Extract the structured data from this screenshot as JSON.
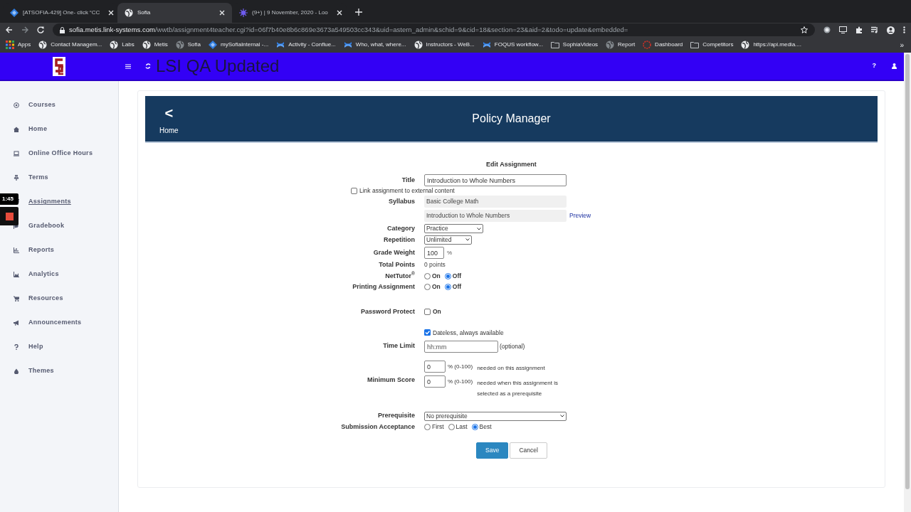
{
  "browser": {
    "tabs": [
      {
        "title": "[ATSOFIA-429] One- click “CC",
        "kind": "diamond",
        "selected": false
      },
      {
        "title": "Sofia",
        "kind": "globe",
        "selected": true
      },
      {
        "title": "(9+) | 9 November, 2020 - Loo",
        "kind": "star",
        "selected": false
      }
    ],
    "url": {
      "host": "sofia.metis.link-systems.com",
      "path": "/wwtb/assignment4teacher.cgi?id=06f7b40e8b6c869e3673a549503cc343&uid=astern_admin&schid=9&cid=18&section=23&aid=2&todo=update&embedded="
    },
    "bookmarks": [
      {
        "label": "Apps",
        "kind": "grid"
      },
      {
        "label": "Contact Managem...",
        "kind": "globe"
      },
      {
        "label": "Labs",
        "kind": "globe"
      },
      {
        "label": "Metis",
        "kind": "globe"
      },
      {
        "label": "Sofia",
        "kind": "dim"
      },
      {
        "label": "mySofiaInternal -...",
        "kind": "diamond"
      },
      {
        "label": "Activity - Conflue...",
        "kind": "cross"
      },
      {
        "label": "Who, what, where...",
        "kind": "cross"
      },
      {
        "label": "Instructors - WeB...",
        "kind": "globe"
      },
      {
        "label": "FOQUS workflow...",
        "kind": "cross"
      },
      {
        "label": "SophiaVideos",
        "kind": "folder"
      },
      {
        "label": "Report",
        "kind": "dim"
      },
      {
        "label": "Dashboard",
        "kind": "ring"
      },
      {
        "label": "Competitors",
        "kind": "folder"
      },
      {
        "label": "https://api.media....",
        "kind": "globe"
      }
    ],
    "more": "»"
  },
  "app": {
    "title": "LSI QA Updated",
    "help": "?"
  },
  "sidebar": {
    "items": [
      {
        "label": "Courses",
        "selected": false
      },
      {
        "label": "Home",
        "selected": false
      },
      {
        "label": "Online Office Hours",
        "selected": false
      },
      {
        "label": "Terms",
        "selected": false
      },
      {
        "label": "Assignments",
        "selected": true
      },
      {
        "label": "Gradebook",
        "selected": false
      },
      {
        "label": "Reports",
        "selected": false
      },
      {
        "label": "Analytics",
        "selected": false
      },
      {
        "label": "Resources",
        "selected": false
      },
      {
        "label": "Announcements",
        "selected": false
      },
      {
        "label": "Help",
        "selected": false
      },
      {
        "label": "Themes",
        "selected": false
      }
    ]
  },
  "recorder": {
    "time": "1:45"
  },
  "panel": {
    "back": "<",
    "back_label": "Home",
    "title": "Policy Manager"
  },
  "form": {
    "heading": "Edit Assignment",
    "fields": [
      {
        "kind": "text",
        "label": "Title",
        "value": "Introduction to Whole Numbers"
      },
      {
        "kind": "checkline",
        "text": "Link assignment to external content",
        "checked": false
      },
      {
        "kind": "readonly",
        "label": "Syllabus",
        "value": "Basic College Math"
      },
      {
        "kind": "readonly",
        "value": "Introduction to Whole Numbers",
        "link": "Preview"
      },
      {
        "kind": "select",
        "label": "Category",
        "value": "Practice"
      },
      {
        "kind": "select",
        "label": "Repetition",
        "value": "Unlimited"
      },
      {
        "kind": "number",
        "label": "Grade Weight",
        "value": "100",
        "unit": "%"
      },
      {
        "kind": "static",
        "label": "Total Points",
        "value": "0 points"
      },
      {
        "kind": "radios",
        "label": "NetTutor$^{®}$",
        "options": [
          {
            "label": "On",
            "selected": false
          },
          {
            "label": "Off",
            "selected": true
          }
        ]
      },
      {
        "kind": "radios",
        "label": "Printing Assignment",
        "options": [
          {
            "label": "On",
            "selected": false
          },
          {
            "label": "Off",
            "selected": true
          }
        ]
      },
      {
        "kind": "checkbox",
        "label": "Password Protect",
        "text": "On",
        "checked": false
      },
      {
        "kind": "time",
        "label": "Time Limit",
        "check_text": "Dateless, always available",
        "checked": true,
        "placeholder": "hh:mm",
        "note": "(optional)"
      },
      {
        "kind": "scores",
        "label": "Minimum Score",
        "lines": [
          {
            "value": "0",
            "unit": "% (0-100)",
            "text": "needed on this assignment"
          },
          {
            "value": "0",
            "unit": "% (0-100)",
            "text": "needed when this assignment is selected as a prerequisite"
          }
        ]
      },
      {
        "kind": "select",
        "label": "Prerequisite",
        "value": "No prerequisite",
        "wide": true
      },
      {
        "kind": "radios",
        "label": "Submission Acceptance",
        "light": true,
        "options": [
          {
            "label": "First",
            "selected": false
          },
          {
            "label": "Last",
            "selected": false
          },
          {
            "label": "Best",
            "selected": true
          }
        ]
      }
    ],
    "buttons": [
      {
        "label": "Save",
        "primary": true
      },
      {
        "label": "Cancel",
        "primary": false
      }
    ]
  }
}
